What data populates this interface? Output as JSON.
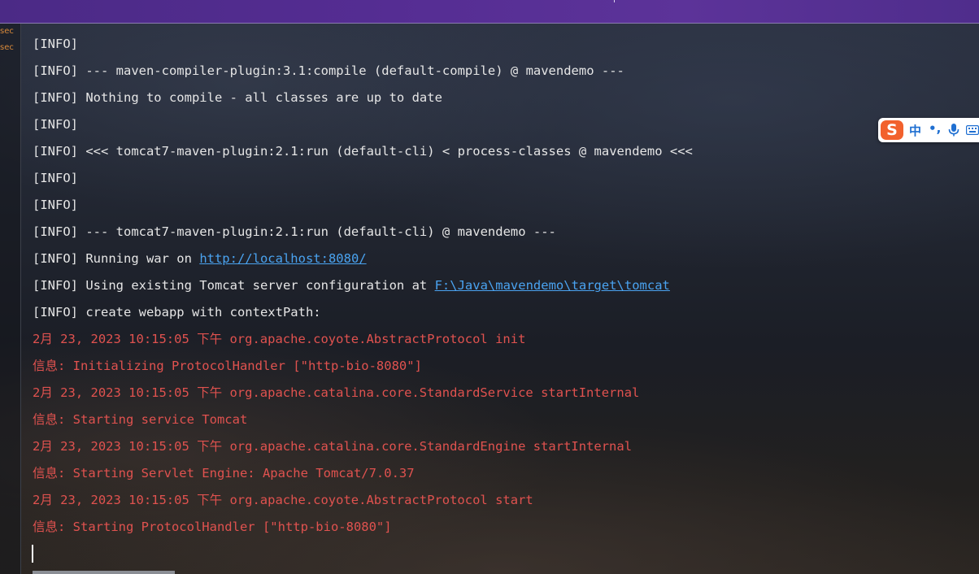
{
  "gutter": {
    "labels": [
      "sec",
      "sec"
    ]
  },
  "console": {
    "lines": [
      {
        "text": "[INFO]",
        "type": "info"
      },
      {
        "text": "[INFO] --- maven-compiler-plugin:3.1:compile (default-compile) @ mavendemo ---",
        "type": "info"
      },
      {
        "text": "[INFO] Nothing to compile - all classes are up to date",
        "type": "info"
      },
      {
        "text": "[INFO]",
        "type": "info"
      },
      {
        "text": "[INFO] <<< tomcat7-maven-plugin:2.1:run (default-cli) < process-classes @ mavendemo <<<",
        "type": "info"
      },
      {
        "text": "[INFO]",
        "type": "info"
      },
      {
        "text": "[INFO]",
        "type": "info"
      },
      {
        "text": "[INFO] --- tomcat7-maven-plugin:2.1:run (default-cli) @ mavendemo ---",
        "type": "info"
      },
      {
        "text": "[INFO] Running war on ",
        "type": "info",
        "link": "http://localhost:8080/"
      },
      {
        "text": "[INFO] Using existing Tomcat server configuration at ",
        "type": "info",
        "link": "F:\\Java\\mavendemo\\target\\tomcat"
      },
      {
        "text": "[INFO] create webapp with contextPath:",
        "type": "info"
      },
      {
        "text": "2月 23, 2023 10:15:05 下午 org.apache.coyote.AbstractProtocol init",
        "type": "err"
      },
      {
        "text": "信息: Initializing ProtocolHandler [\"http-bio-8080\"]",
        "type": "err"
      },
      {
        "text": "2月 23, 2023 10:15:05 下午 org.apache.catalina.core.StandardService startInternal",
        "type": "err"
      },
      {
        "text": "信息: Starting service Tomcat",
        "type": "err"
      },
      {
        "text": "2月 23, 2023 10:15:05 下午 org.apache.catalina.core.StandardEngine startInternal",
        "type": "err"
      },
      {
        "text": "信息: Starting Servlet Engine: Apache Tomcat/7.0.37",
        "type": "err"
      },
      {
        "text": "2月 23, 2023 10:15:05 下午 org.apache.coyote.AbstractProtocol start",
        "type": "err"
      },
      {
        "text": "信息: Starting ProtocolHandler [\"http-bio-8080\"]",
        "type": "err"
      }
    ]
  },
  "ime": {
    "logo": "S",
    "mode": "中",
    "punct": "•,",
    "mic_icon": "microphone-icon",
    "keyboard_icon": "keyboard-icon"
  },
  "colors": {
    "info_text": "#e6e6e6",
    "error_text": "#e0524f",
    "link": "#4aa3f0",
    "top_bar": "#552d93",
    "ime_logo": "#f2612d",
    "ime_accent": "#1f6fd1"
  }
}
